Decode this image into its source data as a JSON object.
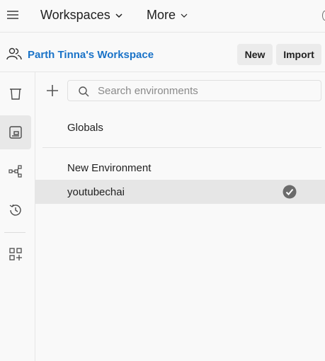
{
  "topbar": {
    "workspaces_label": "Workspaces",
    "more_label": "More"
  },
  "workspace": {
    "name": "Parth Tinna's Workspace",
    "new_label": "New",
    "import_label": "Import"
  },
  "sidebar": {
    "items": [
      {
        "icon": "collections-icon"
      },
      {
        "icon": "environments-icon",
        "active": true
      },
      {
        "icon": "flows-icon"
      },
      {
        "icon": "history-icon"
      },
      {
        "icon": "add-apps-icon"
      }
    ]
  },
  "environments": {
    "search_placeholder": "Search environments",
    "search_value": "",
    "globals_label": "Globals",
    "items": [
      {
        "label": "New Environment",
        "active": false
      },
      {
        "label": "youtubechai",
        "active": true
      }
    ]
  },
  "colors": {
    "accent": "#1a73c8",
    "selected_row": "#e6e6e6",
    "check_badge": "#6b6b6b"
  }
}
